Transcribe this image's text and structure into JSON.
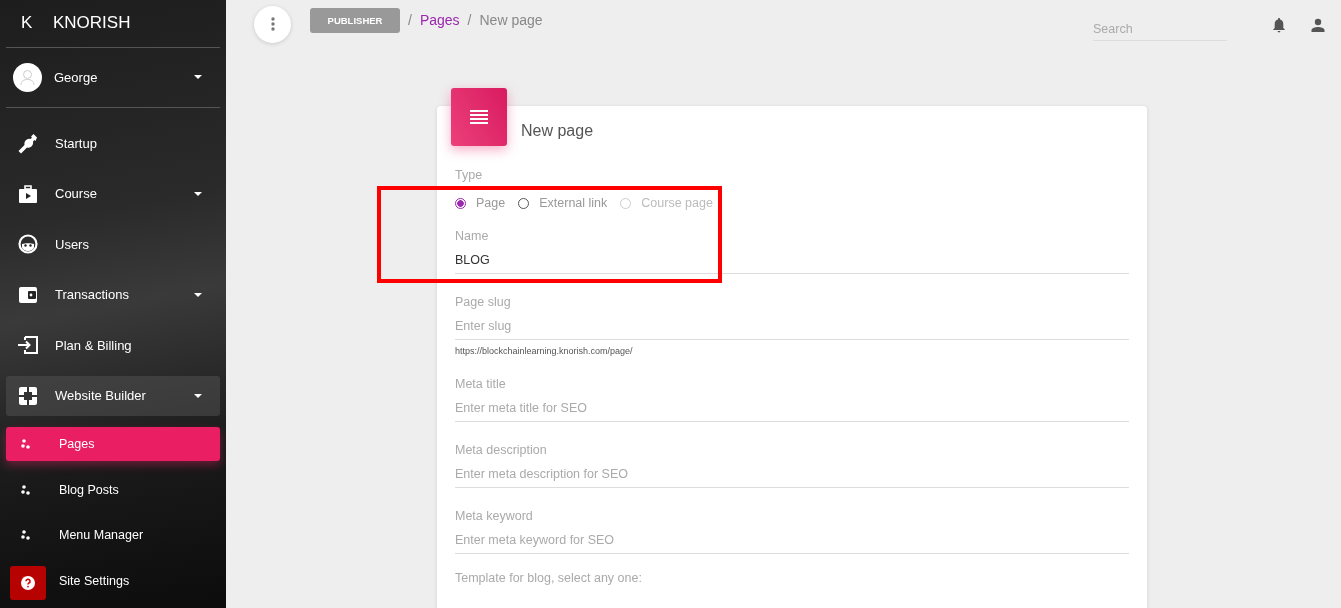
{
  "sidebar": {
    "brand": {
      "letter": "K",
      "name": "KNORISH"
    },
    "user": {
      "name": "George"
    },
    "items": [
      {
        "label": "Startup",
        "caret": false,
        "expanded": false
      },
      {
        "label": "Course",
        "caret": true,
        "expanded": false
      },
      {
        "label": "Users",
        "caret": false,
        "expanded": false
      },
      {
        "label": "Transactions",
        "caret": true,
        "expanded": false
      },
      {
        "label": "Plan & Billing",
        "caret": false,
        "expanded": false
      },
      {
        "label": "Website Builder",
        "caret": true,
        "expanded": true,
        "children": [
          {
            "label": "Pages",
            "selected": true
          },
          {
            "label": "Blog Posts",
            "selected": false
          },
          {
            "label": "Menu Manager",
            "selected": false
          },
          {
            "label": "Site Settings",
            "selected": false
          }
        ]
      }
    ]
  },
  "topbar": {
    "breadcrumb": [
      {
        "kind": "badge",
        "text": "PUBLISHER"
      },
      {
        "kind": "separator",
        "text": "/"
      },
      {
        "kind": "link",
        "text": "Pages"
      },
      {
        "kind": "separator",
        "text": "/"
      },
      {
        "kind": "current",
        "text": "New page"
      }
    ],
    "search": {
      "placeholder": "Search"
    }
  },
  "card": {
    "title": "New page",
    "type": {
      "label": "Type",
      "options": [
        {
          "label": "Page",
          "selected": true,
          "disabled": false
        },
        {
          "label": "External link",
          "selected": false,
          "disabled": false
        },
        {
          "label": "Course page",
          "selected": false,
          "disabled": true
        }
      ]
    },
    "fields": [
      {
        "label": "Name",
        "value": "BLOG"
      },
      {
        "label": "Page slug",
        "placeholder": "Enter slug",
        "hint": "https://blockchainlearning.knorish.com/page/"
      },
      {
        "label": "Meta title",
        "placeholder": "Enter meta title for SEO"
      },
      {
        "label": "Meta description",
        "placeholder": "Enter meta description for SEO"
      },
      {
        "label": "Meta keyword",
        "placeholder": "Enter meta keyword for SEO"
      }
    ],
    "template_label": "Template for blog, select any one:"
  }
}
